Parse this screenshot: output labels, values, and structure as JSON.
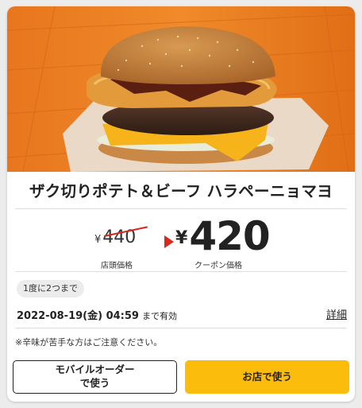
{
  "product": {
    "name": "ザク切りポテト＆ビーフ ハラペーニョマヨ"
  },
  "price": {
    "currency_symbol": "¥",
    "original": "440",
    "original_label": "店頭価格",
    "coupon": "420",
    "coupon_label": "クーポン価格"
  },
  "usage_limit": "1度に2つまで",
  "expiry": {
    "date": "2022-08-19(金) 04:59",
    "suffix": "まで有効"
  },
  "details_link": "詳細",
  "notice": "※辛味が苦手な方はご注意ください。",
  "buttons": {
    "mobile_order_line1": "モバイルオーダー",
    "mobile_order_line2": "で使う",
    "in_store": "お店で使う"
  },
  "colors": {
    "accent_yellow": "#fcbc0c",
    "strike_red": "#d8281f"
  }
}
